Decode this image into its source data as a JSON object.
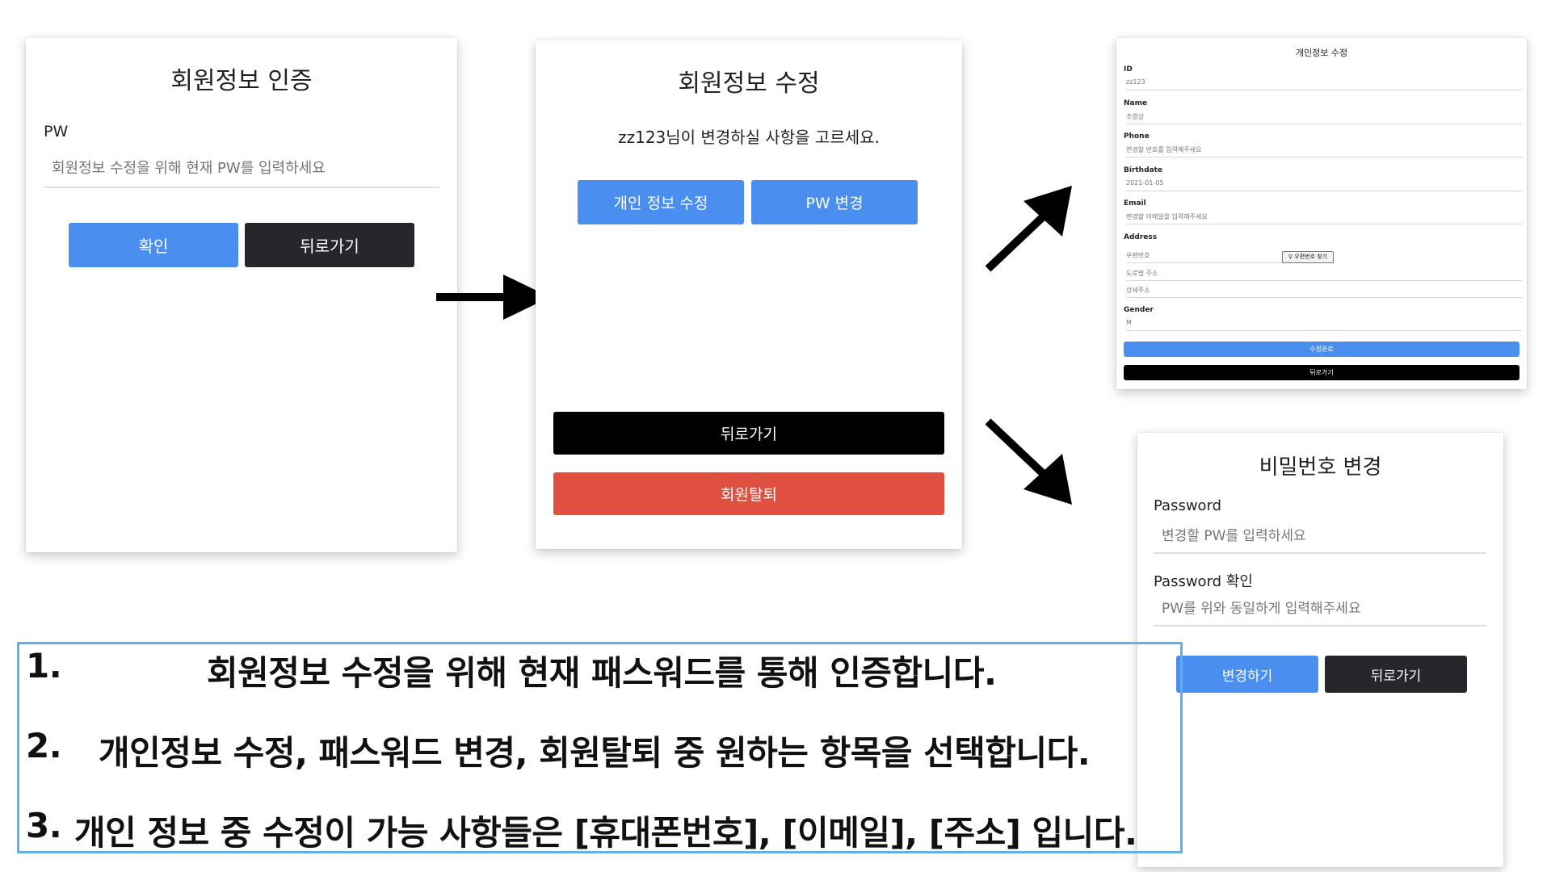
{
  "auth_card": {
    "title": "회원정보 인증",
    "pw_label": "PW",
    "pw_placeholder": "회원정보 수정을 위해 현재 PW를 입력하세요",
    "confirm_label": "확인",
    "back_label": "뒤로가기"
  },
  "edit_card": {
    "title": "회원정보 수정",
    "prompt": "zz123님이 변경하실 사항을 고르세요.",
    "personal_label": "개인 정보 수정",
    "pw_change_label": "PW 변경",
    "back_label": "뒤로가기",
    "withdraw_label": "회원탈퇴"
  },
  "personal_card": {
    "title": "개인정보 수정",
    "fields": [
      {
        "label": "ID",
        "value": "zz123"
      },
      {
        "label": "Name",
        "value": "조영상"
      },
      {
        "label": "Phone",
        "value": "변경할 번호를 입력해주세요"
      },
      {
        "label": "Birthdate",
        "value": "2021-01-05"
      },
      {
        "label": "Email",
        "value": "변경할 이메일을 입력해주세요"
      }
    ],
    "address_label": "Address",
    "zip_placeholder": "우편번호",
    "zip_button": "우편번호 찾기",
    "road_placeholder": "도로명 주소",
    "detail_placeholder": "상세주소",
    "gender_label": "Gender",
    "gender_value": "M",
    "submit_label": "수정완료",
    "back_label": "뒤로가기"
  },
  "password_card": {
    "title": "비밀번호 변경",
    "password_label": "Password",
    "password_placeholder": "변경할 PW를 입력하세요",
    "confirm_label": "Password 확인",
    "confirm_placeholder": "PW를 위와 동일하게 입력해주세요",
    "change_label": "변경하기",
    "back_label": "뒤로가기"
  },
  "captions": {
    "line1_num": "1.",
    "line1": "회원정보 수정을 위해 현재 패스워드를 통해 인증합니다.",
    "line2_num": "2.",
    "line2": "개인정보 수정,  패스워드 변경,  회원탈퇴 중 원하는 항목을 선택합니다.",
    "line3_num": "3.",
    "line3": "개인 정보 중 수정이 가능 사항들은 [휴대폰번호], [이메일], [주소] 입니다."
  },
  "colors": {
    "primary_blue": "#4a8ff0",
    "dark_button": "#25272a",
    "danger_red": "#e05041",
    "caption_border": "#5fb0e8"
  }
}
